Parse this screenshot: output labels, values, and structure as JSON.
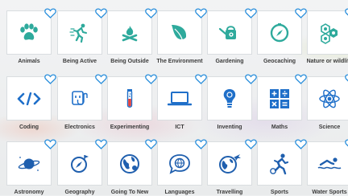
{
  "colors": {
    "icon_accent": "#2eaa9c",
    "heart_outline": "#2a8fdc",
    "label_text": "#3b3b3b"
  },
  "tiles": [
    {
      "label": "Animals",
      "icon": "paw-print-icon"
    },
    {
      "label": "Being Active",
      "icon": "running-person-icon"
    },
    {
      "label": "Being Outside",
      "icon": "campfire-icon"
    },
    {
      "label": "The Environment",
      "icon": "leaves-icon"
    },
    {
      "label": "Gardening",
      "icon": "watering-can-icon"
    },
    {
      "label": "Geocaching",
      "icon": "compass-icon"
    },
    {
      "label": "Nature or wildlife",
      "icon": "nature-hexagons-icon"
    },
    {
      "label": "Coding",
      "icon": "code-brackets-icon"
    },
    {
      "label": "Electronics",
      "icon": "plug-socket-icon"
    },
    {
      "label": "Experimenting",
      "icon": "test-tube-icon"
    },
    {
      "label": "ICT",
      "icon": "laptop-icon"
    },
    {
      "label": "Inventing",
      "icon": "lightbulb-icon"
    },
    {
      "label": "Maths",
      "icon": "calculator-symbols-icon"
    },
    {
      "label": "Science",
      "icon": "atom-icon"
    },
    {
      "label": "Astronomy",
      "icon": "planet-icon"
    },
    {
      "label": "Geography",
      "icon": "compass-flag-icon"
    },
    {
      "label": "Going To New",
      "icon": "globe-icon"
    },
    {
      "label": "Languages",
      "icon": "speech-bubble-globe-icon"
    },
    {
      "label": "Travelling",
      "icon": "globe-plane-icon"
    },
    {
      "label": "Sports",
      "icon": "footballer-icon"
    },
    {
      "label": "Water Sports",
      "icon": "swimmer-icon"
    }
  ]
}
